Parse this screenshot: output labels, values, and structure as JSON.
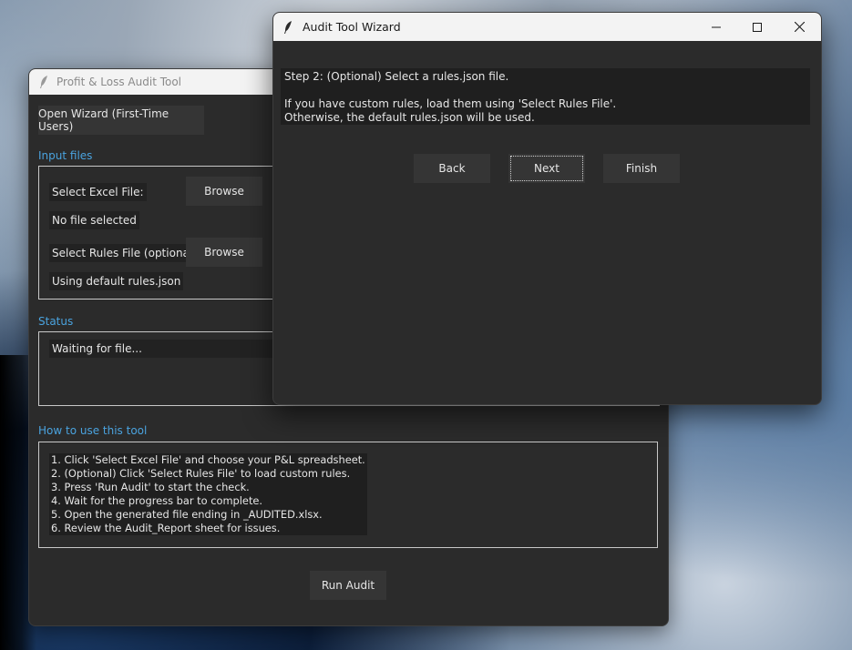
{
  "main_window": {
    "title": "Profit & Loss Audit Tool",
    "open_wizard_label": "Open Wizard (First-Time Users)",
    "input_files_label": "Input files",
    "select_excel_label": "Select Excel File:",
    "browse_excel_label": "Browse",
    "excel_status": "No file selected",
    "select_rules_label": "Select Rules File (optional):",
    "browse_rules_label": "Browse",
    "rules_status": "Using default rules.json",
    "status_label": "Status",
    "status_text": "Waiting for file...",
    "howto_label": "How to use this tool",
    "howto_lines": [
      "1. Click 'Select Excel File' and choose your P&L spreadsheet.",
      "2. (Optional) Click 'Select Rules File' to load custom rules.",
      "3. Press 'Run Audit' to start the check.",
      "4. Wait for the progress bar to complete.",
      "5. Open the generated file ending in _AUDITED.xlsx.",
      "6. Review the Audit_Report sheet for issues."
    ],
    "run_audit_label": "Run Audit"
  },
  "wizard": {
    "title": "Audit Tool Wizard",
    "step_lines": [
      "Step 2: (Optional) Select a rules.json file.",
      "",
      "If you have custom rules, load them using 'Select Rules File'.",
      "Otherwise, the default rules.json will be used."
    ],
    "back_label": "Back",
    "next_label": "Next",
    "finish_label": "Finish"
  },
  "colors": {
    "accent_label": "#4aa3df",
    "window_bg": "#2b2b2b",
    "button_bg": "#353535",
    "titlebar_bg": "#f3f3f3"
  },
  "icons": [
    "feather-icon",
    "minimize-icon",
    "maximize-icon",
    "close-icon"
  ]
}
